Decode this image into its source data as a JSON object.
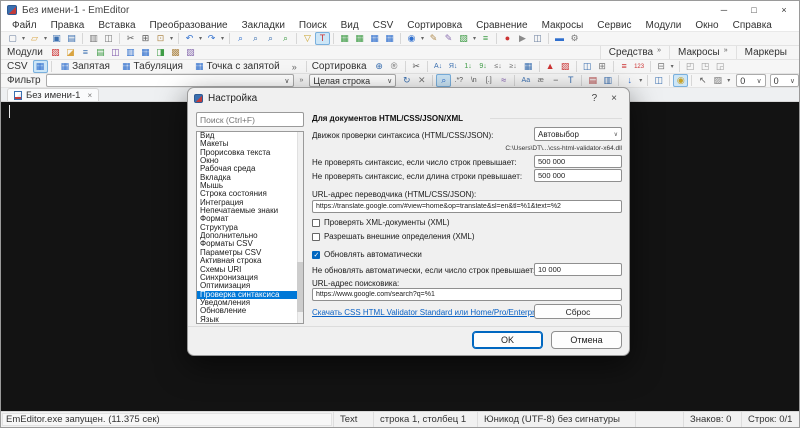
{
  "window": {
    "title": "Без имени-1 - EmEditor",
    "controls": {
      "minimize": "─",
      "maximize": "□",
      "close": "×"
    }
  },
  "menu": {
    "items": [
      "Файл",
      "Правка",
      "Вставка",
      "Преобразование",
      "Закладки",
      "Поиск",
      "Вид",
      "CSV",
      "Сортировка",
      "Сравнение",
      "Макросы",
      "Сервис",
      "Модули",
      "Окно",
      "Справка"
    ]
  },
  "toolbar_main": {
    "icons": [
      {
        "name": "new-file-icon",
        "glyph": "▢",
        "css": "color:#6b7f9e"
      },
      {
        "cls": "tarrow",
        "name": "new-file-dropdown-icon",
        "glyph": "▾"
      },
      {
        "name": "open-icon",
        "glyph": "▱",
        "css": "color:#d9a441"
      },
      {
        "cls": "tarrow",
        "name": "open-dropdown-icon",
        "glyph": "▾"
      },
      {
        "name": "save-icon",
        "glyph": "▣",
        "css": "color:#3a6fb0"
      },
      {
        "name": "save-all-icon",
        "glyph": "▤",
        "css": "color:#3a6fb0"
      },
      {
        "cls": "tsep",
        "name": "separator",
        "glyph": ""
      },
      {
        "name": "print-icon",
        "glyph": "▥",
        "css": "color:#777777"
      },
      {
        "name": "print-preview-icon",
        "glyph": "◫",
        "css": "color:#777777"
      },
      {
        "cls": "tsep",
        "name": "separator",
        "glyph": ""
      },
      {
        "name": "cut-icon",
        "glyph": "✂",
        "css": "color:#555555"
      },
      {
        "name": "copy-icon",
        "glyph": "⊞",
        "css": "color:#555555"
      },
      {
        "name": "paste-icon",
        "glyph": "⊡",
        "css": "color:#b08b4f"
      },
      {
        "cls": "tarrow",
        "name": "paste-dropdown-icon",
        "glyph": "▾"
      },
      {
        "cls": "tsep",
        "name": "separator",
        "glyph": ""
      },
      {
        "name": "undo-icon",
        "glyph": "↶",
        "css": "color:#2f6fce"
      },
      {
        "cls": "tarrow",
        "name": "undo-dropdown-icon",
        "glyph": "▾"
      },
      {
        "name": "redo-icon",
        "glyph": "↷",
        "css": "color:#2f6fce"
      },
      {
        "cls": "tarrow",
        "name": "redo-dropdown-icon",
        "glyph": "▾"
      },
      {
        "cls": "tsep",
        "name": "separator",
        "glyph": ""
      },
      {
        "name": "find-icon",
        "glyph": "⌕",
        "css": "color:#2f6fce"
      },
      {
        "name": "find-next-icon",
        "glyph": "⌕",
        "css": "color:#3a6fb0"
      },
      {
        "name": "find-previous-icon",
        "glyph": "⌕",
        "css": "color:#3a6fb0"
      },
      {
        "name": "find-in-files-icon",
        "glyph": "⌕",
        "css": "color:#3f9c46"
      },
      {
        "cls": "tsep",
        "name": "separator",
        "glyph": ""
      },
      {
        "name": "filter-icon",
        "glyph": "▽",
        "css": "color:#c9a227"
      },
      {
        "name": "highlight-icon",
        "glyph": "Т",
        "css": "color:#cc3333",
        "state": "on"
      },
      {
        "cls": "tsep",
        "name": "separator",
        "glyph": ""
      },
      {
        "name": "html-bar-icon",
        "glyph": "▦",
        "css": "color:#3f9c46"
      },
      {
        "name": "web-preview-icon",
        "glyph": "▦",
        "css": "color:#3f9c46"
      },
      {
        "name": "compare-icon",
        "glyph": "▦",
        "css": "color:#2f6fce"
      },
      {
        "name": "sync-scroll-icon",
        "glyph": "▦",
        "css": "color:#2f6fce"
      },
      {
        "cls": "tsep",
        "name": "separator",
        "glyph": ""
      },
      {
        "name": "plugins-icon",
        "glyph": "◉",
        "css": "color:#2f6fce"
      },
      {
        "cls": "tarrow",
        "name": "plugins-dropdown-icon",
        "glyph": "▾"
      },
      {
        "name": "customize-icon",
        "glyph": "✎",
        "css": "color:#b08b4f"
      },
      {
        "name": "edit-snippets-icon",
        "glyph": "✎",
        "css": "color:#8a6fb0"
      },
      {
        "name": "snapshot-icon",
        "glyph": "▨",
        "css": "color:#3f9c46"
      },
      {
        "cls": "tarrow",
        "name": "snapshot-dropdown-icon",
        "glyph": "▾"
      },
      {
        "name": "outline-icon",
        "glyph": "≡",
        "css": "color:#3f9c46"
      },
      {
        "cls": "tsep",
        "name": "separator",
        "glyph": ""
      },
      {
        "name": "record-macro-icon",
        "glyph": "●",
        "css": "color:#cc3333"
      },
      {
        "name": "run-macro-icon",
        "glyph": "▶",
        "css": "color:#8a8a8a"
      },
      {
        "name": "macros-list-icon",
        "glyph": "◫",
        "css": "color:#6b7f9e"
      },
      {
        "cls": "tsep",
        "name": "separator",
        "glyph": ""
      },
      {
        "name": "panel-icon",
        "glyph": "▬",
        "css": "color:#2f6fce"
      },
      {
        "name": "wrench-icon",
        "glyph": "⚙",
        "css": "color:#777777"
      }
    ]
  },
  "toolbar_modules": {
    "label": "Модули",
    "icons": [
      {
        "name": "projects-module-icon",
        "glyph": "▧",
        "css": "color:#cc3333"
      },
      {
        "name": "snippets-module-icon",
        "glyph": "◪",
        "css": "color:#d9a441"
      },
      {
        "name": "outline-module-icon",
        "glyph": "≡",
        "css": "color:#3a6fb0"
      },
      {
        "name": "word-count-module-icon",
        "glyph": "▤",
        "css": "color:#3f9c46"
      },
      {
        "name": "html-bar-module-icon",
        "glyph": "◫",
        "css": "color:#7a52a8"
      },
      {
        "name": "web-preview-module-icon",
        "glyph": "▥",
        "css": "color:#2f6fce"
      },
      {
        "name": "character-map-module-icon",
        "glyph": "▦",
        "css": "color:#2f6fce"
      },
      {
        "name": "clipboard-history-module-icon",
        "glyph": "◨",
        "css": "color:#3f9c46"
      },
      {
        "name": "open-documents-module-icon",
        "glyph": "▩",
        "css": "color:#b08b4f"
      },
      {
        "name": "tools-module-icon",
        "glyph": "▨",
        "css": "color:#8a6fb0"
      }
    ]
  },
  "toolbar_right": {
    "buttons": [
      {
        "name": "tools-button",
        "label": "Средства",
        "chevron": "»"
      },
      {
        "name": "macros-button",
        "label": "Макросы",
        "chevron": "»"
      },
      {
        "name": "markers-button",
        "label": "Маркеры",
        "chevron": ""
      }
    ]
  },
  "toolbar_csv": {
    "label": "CSV",
    "mode_icon": "▦",
    "buttons": [
      {
        "name": "csv-comma-button",
        "icon": "▦",
        "label": "Запятая"
      },
      {
        "name": "csv-tab-button",
        "icon": "▦",
        "label": "Табуляция"
      },
      {
        "name": "csv-semicolon-button",
        "icon": "▦",
        "label": "Точка с запятой"
      }
    ],
    "overflow_chevron": "»",
    "sort_label": "Сортировка",
    "sort_icons": [
      {
        "name": "sort-move-icon",
        "glyph": "⊕",
        "css": "color:#3a6fb0"
      },
      {
        "name": "sort-reverse-icon",
        "glyph": "®",
        "css": "color:#777777"
      },
      {
        "cls": "tsep",
        "name": "separator",
        "glyph": ""
      },
      {
        "name": "cut-columns-icon",
        "glyph": "✂",
        "css": "color:#555555"
      },
      {
        "cls": "tsep",
        "name": "separator",
        "glyph": ""
      },
      {
        "name": "sort-az-ascending-icon",
        "glyph": "А↓",
        "css": "color:#3a6fb0;font-size:7px"
      },
      {
        "name": "sort-az-descending-icon",
        "glyph": "Я↓",
        "css": "color:#3a6fb0;font-size:7px"
      },
      {
        "name": "sort-num-ascending-icon",
        "glyph": "1↓",
        "css": "color:#3f9c46;font-size:7px"
      },
      {
        "name": "sort-num-descending-icon",
        "glyph": "9↓",
        "css": "color:#3f9c46;font-size:7px"
      },
      {
        "name": "sort-length-ascending-icon",
        "glyph": "≤↓",
        "css": "color:#777777;font-size:7px"
      },
      {
        "name": "sort-length-descending-icon",
        "glyph": "≥↓",
        "css": "color:#777777;font-size:7px"
      },
      {
        "name": "sort-dialog-icon",
        "glyph": "▦",
        "css": "color:#3a6fb0"
      },
      {
        "cls": "tsep",
        "name": "separator",
        "glyph": ""
      },
      {
        "name": "delete-duplicates-icon",
        "glyph": "▲",
        "css": "color:#cc3333"
      },
      {
        "name": "merge-duplicates-icon",
        "glyph": "▨",
        "css": "color:#cc3333"
      },
      {
        "cls": "tsep",
        "name": "separator",
        "glyph": ""
      },
      {
        "name": "split-column-icon",
        "glyph": "◫",
        "css": "color:#3a6fb0"
      },
      {
        "name": "combine-lines-icon",
        "glyph": "⊞",
        "css": "color:#777777"
      },
      {
        "cls": "tsep",
        "name": "separator",
        "glyph": ""
      },
      {
        "name": "numbering-icon",
        "glyph": "≡",
        "css": "color:#cc3333"
      },
      {
        "name": "line-numbers-icon",
        "glyph": "123",
        "css": "color:#cc3333;font-size:6px"
      },
      {
        "cls": "tsep",
        "name": "separator",
        "glyph": ""
      },
      {
        "name": "column-options-icon",
        "glyph": "⊟",
        "css": "color:#777777"
      },
      {
        "cls": "tarrow",
        "name": "column-options-dropdown-icon",
        "glyph": "▾"
      },
      {
        "cls": "tsep",
        "name": "separator",
        "glyph": ""
      },
      {
        "name": "pivot-table-icon",
        "glyph": "◰",
        "css": "color:#999999"
      },
      {
        "name": "unpivot-icon",
        "glyph": "◳",
        "css": "color:#999999"
      },
      {
        "name": "transpose-icon",
        "glyph": "◲",
        "css": "color:#999999"
      }
    ]
  },
  "toolbar_filter": {
    "label": "Фильтр",
    "filter_value": "",
    "filter_chevron": "∨",
    "mini_chevron": "»",
    "scope_value": "Целая строка",
    "scope_chevron": "∨",
    "icons": [
      {
        "name": "filter-refresh-icon",
        "glyph": "↻",
        "css": "color:#3a6fb0"
      },
      {
        "name": "filter-clear-icon",
        "glyph": "✕",
        "css": "color:#777777"
      },
      {
        "cls": "tsep",
        "name": "separator",
        "glyph": ""
      },
      {
        "name": "filter-search-icon",
        "glyph": "⌕",
        "css": "color:#2f6fce",
        "state": "on"
      },
      {
        "name": "regex-icon",
        "glyph": ".*?",
        "css": "color:#555555;font-size:7px"
      },
      {
        "name": "escape-sequence-icon",
        "glyph": "\\n",
        "css": "color:#555555;font-size:7px"
      },
      {
        "name": "number-range-icon",
        "glyph": "[.]",
        "css": "color:#555555;font-size:7px"
      },
      {
        "name": "fuzzy-match-icon",
        "glyph": "≈",
        "css": "color:#7a52a8"
      },
      {
        "cls": "tsep",
        "name": "separator",
        "glyph": ""
      },
      {
        "name": "match-case-icon",
        "glyph": "Аа",
        "css": "color:#3a6fb0;font-size:7px"
      },
      {
        "name": "accent-insensitive-icon",
        "glyph": "æ",
        "css": "color:#777777;font-size:7px"
      },
      {
        "name": "negative-filter-icon",
        "glyph": "−",
        "css": "color:#555555"
      },
      {
        "name": "column-filter-icon",
        "glyph": "Т",
        "css": "color:#3a6fb0"
      },
      {
        "cls": "tsep",
        "name": "separator",
        "glyph": ""
      },
      {
        "name": "filter-document-icon",
        "glyph": "▤",
        "css": "color:#b03b3b"
      },
      {
        "name": "filter-all-documents-icon",
        "glyph": "▥",
        "css": "color:#3a6fb0"
      },
      {
        "cls": "tsep",
        "name": "separator",
        "glyph": ""
      },
      {
        "name": "extract-lines-icon",
        "glyph": "↓",
        "css": "color:#2f6fce"
      },
      {
        "cls": "tarrow",
        "name": "extract-dropdown-icon",
        "glyph": "▾"
      },
      {
        "cls": "tsep",
        "name": "separator",
        "glyph": ""
      },
      {
        "name": "filter-panel-icon",
        "glyph": "◫",
        "css": "color:#3a6fb0"
      },
      {
        "cls": "tsep",
        "name": "separator",
        "glyph": ""
      },
      {
        "name": "protect-columns-icon",
        "glyph": "◉",
        "css": "color:#c9a227",
        "state": "on"
      },
      {
        "cls": "tsep",
        "name": "separator",
        "glyph": ""
      },
      {
        "name": "pointer-icon",
        "glyph": "↖",
        "css": "color:#555555"
      },
      {
        "name": "filter-settings-icon",
        "glyph": "▨",
        "css": "color:#777777"
      },
      {
        "cls": "tarrow",
        "name": "filter-settings-dropdown-icon",
        "glyph": "▾"
      }
    ],
    "counter1": "0",
    "counter2": "0",
    "counter_chevron": "∨"
  },
  "tabs": {
    "active_label": "Без имени-1",
    "close_glyph": "×"
  },
  "dialog": {
    "title": "Настройка",
    "help_button": "?",
    "close_button": "×",
    "search_placeholder": "Поиск (Ctrl+F)",
    "sidebar": {
      "items": [
        {
          "label": "Вид"
        },
        {
          "label": "Макеты"
        },
        {
          "label": "Прорисовка текста"
        },
        {
          "label": "Окно"
        },
        {
          "label": "Рабочая среда"
        },
        {
          "label": "Вкладка"
        },
        {
          "label": "Мышь"
        },
        {
          "label": "Строка состояния"
        },
        {
          "label": "Интеграция"
        },
        {
          "label": "Непечатаемые знаки"
        },
        {
          "label": "Формат"
        },
        {
          "label": "Структура"
        },
        {
          "label": "Дополнительно"
        },
        {
          "label": "Форматы CSV"
        },
        {
          "label": "Параметры CSV"
        },
        {
          "label": "Активная строка"
        },
        {
          "label": "Схемы URI"
        },
        {
          "label": "Синхронизация"
        },
        {
          "label": "Оптимизация"
        },
        {
          "label": "Проверка синтаксиса",
          "state": "selected"
        },
        {
          "label": "Уведомления"
        },
        {
          "label": "Обновление"
        },
        {
          "label": "Язык"
        }
      ]
    },
    "panel": {
      "group_heading": "Для документов HTML/CSS/JSON/XML",
      "engine_label": "Движок проверки синтаксиса (HTML/CSS/JSON):",
      "engine_value": "Автовыбор",
      "engine_chevron": "∨",
      "engine_path": "C:\\Users\\DT\\...\\css-html-validator-x64.dll",
      "max_lines_label": "Не проверять синтаксис, если число строк превышает:",
      "max_lines_value": "500 000",
      "max_line_length_label": "Не проверять синтаксис, если длина строки превышает:",
      "max_line_length_value": "500 000",
      "translator_label": "URL-адрес переводчика (HTML/CSS/JSON):",
      "translator_value": "https://translate.google.com/#view=home&op=translate&sl=en&tl=%1&text=%2",
      "check_xml_label": "Проверять XML-документы (XML)",
      "check_xml_checked": false,
      "external_defs_label": "Разрешать внешние определения (XML)",
      "external_defs_checked": false,
      "auto_update_label": "Обновлять автоматически",
      "auto_update_checked": true,
      "no_update_label": "Не обновлять автоматически, если число строк превышает:",
      "no_update_value": "10 000",
      "search_url_label": "URL-адрес поисковика:",
      "search_url_value": "https://www.google.com/search?q=%1",
      "download_link": "Скачать CSS HTML Validator Standard или Home/Pro/Enterprise",
      "reset_button": "Сброс"
    },
    "ok_button": "OK",
    "cancel_button": "Отмена",
    "accent_color": "#0078d7"
  },
  "status_bar": {
    "message": "EmEditor.exe запущен. (11.375 сек)",
    "mode": "Text",
    "position": "строка 1, столбец 1",
    "encoding": "Юникод (UTF-8) без сигнатуры",
    "chars": "Знаков: 0",
    "lines": "Строк: 0/1"
  }
}
